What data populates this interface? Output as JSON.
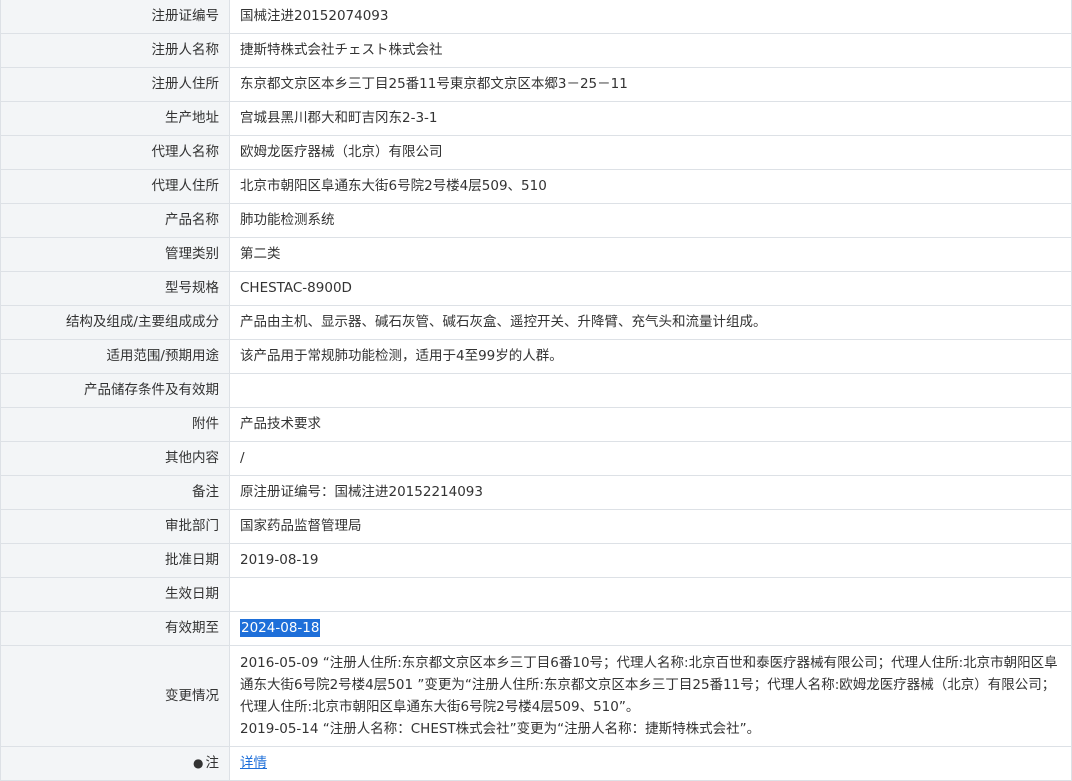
{
  "rows": [
    {
      "label": "注册证编号",
      "value": "国械注进20152074093"
    },
    {
      "label": "注册人名称",
      "value": "捷斯特株式会社チェスト株式会社"
    },
    {
      "label": "注册人住所",
      "value": "东京都文京区本乡三丁目25番11号東京都文京区本郷3－25－11"
    },
    {
      "label": "生产地址",
      "value": "宫城县黑川郡大和町吉冈东2-3-1"
    },
    {
      "label": "代理人名称",
      "value": "欧姆龙医疗器械（北京）有限公司"
    },
    {
      "label": "代理人住所",
      "value": "北京市朝阳区阜通东大街6号院2号楼4层509、510"
    },
    {
      "label": "产品名称",
      "value": "肺功能检测系统"
    },
    {
      "label": "管理类别",
      "value": "第二类"
    },
    {
      "label": "型号规格",
      "value": "CHESTAC-8900D"
    },
    {
      "label": "结构及组成/主要组成成分",
      "value": "产品由主机、显示器、碱石灰管、碱石灰盒、遥控开关、升降臂、充气头和流量计组成。"
    },
    {
      "label": "适用范围/预期用途",
      "value": "该产品用于常规肺功能检测，适用于4至99岁的人群。"
    },
    {
      "label": "产品储存条件及有效期",
      "value": ""
    },
    {
      "label": "附件",
      "value": "产品技术要求"
    },
    {
      "label": "其他内容",
      "value": "/"
    },
    {
      "label": "备注",
      "value": "原注册证编号：国械注进20152214093"
    },
    {
      "label": "审批部门",
      "value": "国家药品监督管理局"
    },
    {
      "label": "批准日期",
      "value": "2019-08-19"
    },
    {
      "label": "生效日期",
      "value": ""
    },
    {
      "label": "有效期至",
      "value": "2024-08-18"
    }
  ],
  "change_info": {
    "label": "变更情况",
    "entry1": "2016-05-09 “注册人住所:东京都文京区本乡三丁目6番10号；代理人名称:北京百世和泰医疗器械有限公司；代理人住所:北京市朝阳区阜通东大街6号院2号楼4层501 ”变更为“注册人住所:东京都文京区本乡三丁目25番11号；代理人名称:欧姆龙医疗器械（北京）有限公司；代理人住所:北京市朝阳区阜通东大街6号院2号楼4层509、510”。",
    "entry2": "2019-05-14 “注册人名称：CHEST株式会社”变更为“注册人名称：捷斯特株式会社”。"
  },
  "note_row": {
    "label": "注",
    "icon": "info-icon",
    "link_text": "详情"
  }
}
